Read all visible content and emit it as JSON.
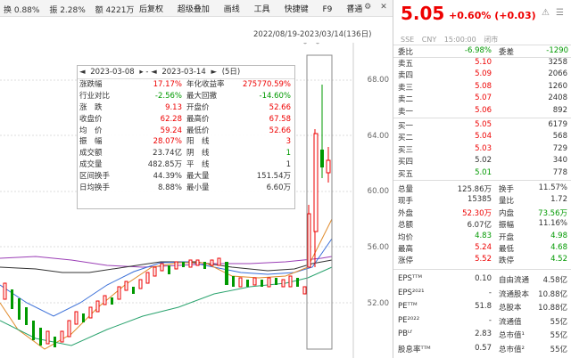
{
  "topbar": {
    "stats": [
      "换 0.88%",
      "振 2.28%",
      "额 4221万"
    ],
    "menu": [
      "后复权",
      "超级叠加",
      "画线",
      "工具",
      "快捷键",
      "F9",
      "普通"
    ],
    "icons": [
      "dropdown-icon",
      "settings-icon",
      "close-icon"
    ]
  },
  "range_label": "2022/08/19-2023/03/14(136日)",
  "yaxis": [
    "68.00",
    "64.00",
    "60.00",
    "56.00",
    "52.00"
  ],
  "panel": {
    "nav_left": "◄",
    "date_from": "2023-03-08",
    "nav_mid": "▸ - ◄",
    "date_to": "2023-03-14",
    "nav_right": "►",
    "days": "(5日)",
    "rows": [
      {
        "l1": "涨跌幅",
        "v1": "17.17%",
        "c1": "red",
        "l2": "年化收益率",
        "v2": "275770.59%",
        "c2": "red"
      },
      {
        "l1": "行业对比",
        "v1": "-2.56%",
        "c1": "green",
        "l2": "最大回撤",
        "v2": "-14.60%",
        "c2": "green"
      },
      {
        "l1": "涨　跌",
        "v1": "9.13",
        "c1": "red",
        "l2": "开盘价",
        "v2": "52.66",
        "c2": "red"
      },
      {
        "l1": "收盘价",
        "v1": "62.28",
        "c1": "red",
        "l2": "最高价",
        "v2": "67.58",
        "c2": "red"
      },
      {
        "l1": "均　价",
        "v1": "59.24",
        "c1": "red",
        "l2": "最低价",
        "v2": "52.66",
        "c2": "red"
      },
      {
        "l1": "振　幅",
        "v1": "28.07%",
        "c1": "red",
        "l2": "阳　线",
        "v2": "3",
        "c2": "red"
      },
      {
        "l1": "成交额",
        "v1": "23.74亿",
        "c1": "",
        "l2": "阴　线",
        "v2": "1",
        "c2": "green"
      },
      {
        "l1": "成交量",
        "v1": "482.85万",
        "c1": "",
        "l2": "平　线",
        "v2": "1",
        "c2": ""
      },
      {
        "l1": "区间换手",
        "v1": "44.39%",
        "c1": "",
        "l2": "最大量",
        "v2": "151.54万",
        "c2": ""
      },
      {
        "l1": "日均换手",
        "v1": "8.88%",
        "c1": "",
        "l2": "最小量",
        "v2": "6.60万",
        "c2": ""
      }
    ]
  },
  "quote": {
    "price": "5.05",
    "change": "+0.60% (+0.03)",
    "market": "SSE",
    "currency": "CNY",
    "time": "15:00:00",
    "status": "闭市",
    "ratio_label": "委比",
    "ratio_value": "-6.98%",
    "diff_label": "委差",
    "diff_value": "-1290",
    "book": [
      {
        "label": "卖五",
        "price": "5.10",
        "color": "red",
        "vol": "3258"
      },
      {
        "label": "卖四",
        "price": "5.09",
        "color": "red",
        "vol": "2066"
      },
      {
        "label": "卖三",
        "price": "5.08",
        "color": "red",
        "vol": "1260"
      },
      {
        "label": "卖二",
        "price": "5.07",
        "color": "red",
        "vol": "2408"
      },
      {
        "label": "卖一",
        "price": "5.06",
        "color": "red",
        "vol": "892"
      },
      {
        "label": "买一",
        "price": "5.05",
        "color": "red",
        "vol": "6179"
      },
      {
        "label": "买二",
        "price": "5.04",
        "color": "red",
        "vol": "568"
      },
      {
        "label": "买三",
        "price": "5.03",
        "color": "red",
        "vol": "729"
      },
      {
        "label": "买四",
        "price": "5.02",
        "color": "",
        "vol": "340"
      },
      {
        "label": "买五",
        "price": "5.01",
        "color": "green",
        "vol": "778"
      }
    ],
    "stats": [
      {
        "l1": "总量",
        "v1": "125.86万",
        "c1": "",
        "l2": "换手",
        "v2": "11.57%",
        "c2": ""
      },
      {
        "l1": "现手",
        "v1": "15385",
        "c1": "",
        "l2": "量比",
        "v2": "1.72",
        "c2": ""
      },
      {
        "l1": "外盘",
        "v1": "52.30万",
        "c1": "red",
        "l2": "内盘",
        "v2": "73.56万",
        "c2": "green"
      },
      {
        "l1": "总额",
        "v1": "6.07亿",
        "c1": "",
        "l2": "振幅",
        "v2": "11.16%",
        "c2": ""
      },
      {
        "l1": "均价",
        "v1": "4.83",
        "c1": "green",
        "l2": "开盘",
        "v2": "4.98",
        "c2": "green"
      },
      {
        "l1": "最高",
        "v1": "5.24",
        "c1": "red",
        "l2": "最低",
        "v2": "4.68",
        "c2": "green"
      },
      {
        "l1": "涨停",
        "v1": "5.52",
        "c1": "red",
        "l2": "跌停",
        "v2": "4.52",
        "c2": "green"
      }
    ],
    "fundamentals": [
      {
        "l1": "EPSᵀᵀᴹ",
        "v1": "0.10",
        "l2": "自由流通",
        "v2": "4.58亿"
      },
      {
        "l1": "EPS²⁰²¹",
        "v1": "-",
        "l2": "流通股本",
        "v2": "10.88亿"
      },
      {
        "l1": "PEᵀᵀᴹ",
        "v1": "51.8",
        "l2": "总股本",
        "v2": "10.88亿"
      },
      {
        "l1": "PE²⁰²²",
        "v1": "-",
        "l2": "流通值",
        "v2": "55亿"
      },
      {
        "l1": "PBᴸᶠ",
        "v1": "2.83",
        "l2": "总市值¹",
        "v2": "55亿"
      },
      {
        "l1": "股息率ᵀᵀᴹ",
        "v1": "0.57",
        "l2": "总市值²",
        "v2": "55亿"
      }
    ]
  }
}
